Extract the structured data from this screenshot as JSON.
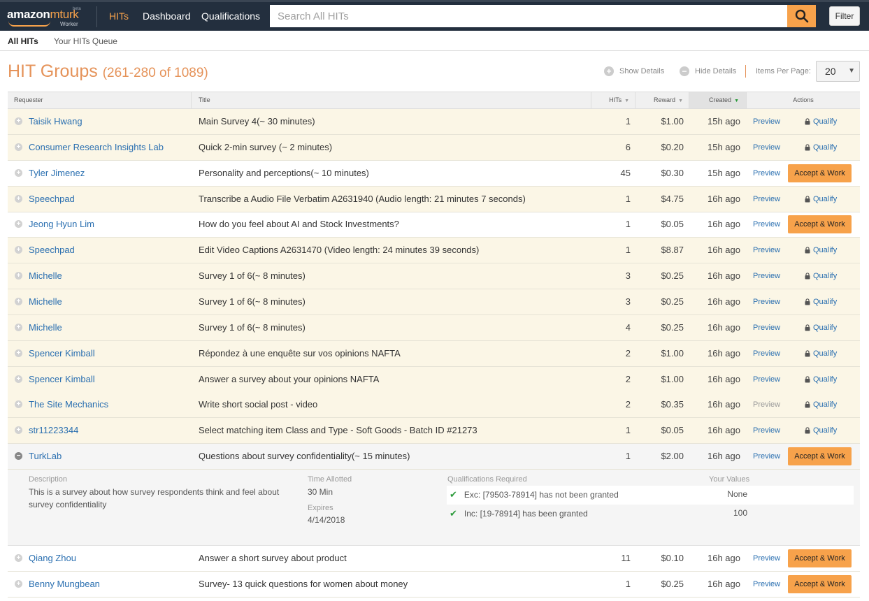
{
  "nav": {
    "brand_amazon": "amazon",
    "brand_mturk": "mturk",
    "brand_beta": "beta",
    "brand_worker": "Worker",
    "links": [
      "HITs",
      "Dashboard",
      "Qualifications"
    ],
    "search_placeholder": "Search All HITs",
    "filter_label": "Filter"
  },
  "subnav": {
    "items": [
      "All HITs",
      "Your HITs Queue"
    ]
  },
  "heading": {
    "title": "HIT Groups",
    "range": "(261-280 of 1089)"
  },
  "controls": {
    "show_details": "Show Details",
    "hide_details": "Hide Details",
    "items_per_page_label": "Items Per Page:",
    "items_per_page_value": "20"
  },
  "columns": {
    "requester": "Requester",
    "title": "Title",
    "hits": "HITs",
    "reward": "Reward",
    "created": "Created",
    "actions": "Actions"
  },
  "labels": {
    "preview": "Preview",
    "qualify": "Qualify",
    "accept": "Accept & Work"
  },
  "rows": [
    {
      "requester": "Taisik Hwang",
      "title": "Main Survey 4(~ 30 minutes)",
      "hits": "1",
      "reward": "$1.00",
      "created": "15h ago"
    },
    {
      "requester": "Consumer Research Insights Lab",
      "title": "Quick 2-min survey (~ 2 minutes)",
      "hits": "6",
      "reward": "$0.20",
      "created": "15h ago"
    },
    {
      "requester": "Tyler Jimenez",
      "title": "Personality and perceptions(~ 10 minutes)",
      "hits": "45",
      "reward": "$0.30",
      "created": "15h ago"
    },
    {
      "requester": "Speechpad",
      "title": "Transcribe a Audio File Verbatim A2631940 (Audio length: 21 minutes 7 seconds)",
      "hits": "1",
      "reward": "$4.75",
      "created": "16h ago"
    },
    {
      "requester": "Jeong Hyun Lim",
      "title": "How do you feel about AI and Stock Investments?",
      "hits": "1",
      "reward": "$0.05",
      "created": "16h ago"
    },
    {
      "requester": "Speechpad",
      "title": "Edit Video Captions A2631470 (Video length: 24 minutes 39 seconds)",
      "hits": "1",
      "reward": "$8.87",
      "created": "16h ago"
    },
    {
      "requester": "Michelle",
      "title": "Survey 1 of 6(~ 8 minutes)",
      "hits": "3",
      "reward": "$0.25",
      "created": "16h ago"
    },
    {
      "requester": "Michelle",
      "title": "Survey 1 of 6(~ 8 minutes)",
      "hits": "3",
      "reward": "$0.25",
      "created": "16h ago"
    },
    {
      "requester": "Michelle",
      "title": "Survey 1 of 6(~ 8 minutes)",
      "hits": "4",
      "reward": "$0.25",
      "created": "16h ago"
    },
    {
      "requester": "Spencer Kimball",
      "title": "Répondez à une enquête sur vos opinions NAFTA",
      "hits": "2",
      "reward": "$1.00",
      "created": "16h ago"
    },
    {
      "requester": "Spencer Kimball",
      "title": "Answer a survey about your opinions NAFTA",
      "hits": "2",
      "reward": "$1.00",
      "created": "16h ago"
    },
    {
      "requester": "The Site Mechanics",
      "title": "Write short social post - video",
      "hits": "2",
      "reward": "$0.35",
      "created": "16h ago"
    },
    {
      "requester": "str11223344",
      "title": "Select matching item Class and Type - Soft Goods - Batch ID #21273",
      "hits": "1",
      "reward": "$0.05",
      "created": "16h ago"
    },
    {
      "requester": "TurkLab",
      "title": "Questions about survey confidentiality(~ 15 minutes)",
      "hits": "1",
      "reward": "$2.00",
      "created": "16h ago"
    },
    {
      "requester": "Qiang Zhou",
      "title": "Answer a short survey about product",
      "hits": "11",
      "reward": "$0.10",
      "created": "16h ago"
    },
    {
      "requester": "Benny Mungbean",
      "title": "Survey- 13 quick questions for women about money",
      "hits": "1",
      "reward": "$0.25",
      "created": "16h ago"
    }
  ],
  "details": {
    "description_label": "Description",
    "description": "This is a survey about how survey respondents think and feel about survey confidentiality",
    "time_allotted_label": "Time Allotted",
    "time_allotted": "30 Min",
    "expires_label": "Expires",
    "expires": "4/14/2018",
    "qualifications_label": "Qualifications Required",
    "your_values_label": "Your Values",
    "qualifications": [
      {
        "text": "Exc: [79503-78914] has not been granted",
        "value": "None"
      },
      {
        "text": "Inc: [19-78914] has been granted",
        "value": "100"
      }
    ]
  },
  "colors": {
    "nav_bg": "#232f3e",
    "accent": "#f7a24b",
    "heading": "#e5935a",
    "link": "#2a6fb0",
    "qual_row_bg": "#fbf6e6"
  }
}
